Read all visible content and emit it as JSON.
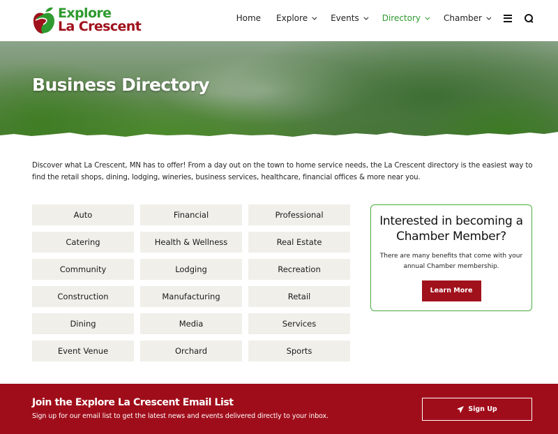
{
  "brand": {
    "line1": "Explore",
    "line2": "La Crescent",
    "colors": {
      "green": "#2e9a2f",
      "red": "#a0111c"
    }
  },
  "nav": {
    "items": [
      {
        "label": "Home",
        "has_dropdown": false,
        "active": false
      },
      {
        "label": "Explore",
        "has_dropdown": true,
        "active": false
      },
      {
        "label": "Events",
        "has_dropdown": true,
        "active": false
      },
      {
        "label": "Directory",
        "has_dropdown": true,
        "active": true
      },
      {
        "label": "Chamber",
        "has_dropdown": true,
        "active": false
      }
    ],
    "menu_icon": "hamburger-icon",
    "search_icon": "search-icon"
  },
  "hero": {
    "title": "Business Directory"
  },
  "intro": {
    "text": "Discover what La Crescent, MN has to offer! From a day out on the town to home service needs, the La Crescent directory is the easiest way to find the retail shops, dining, lodging, wineries, business services, healthcare, financial offices & more near you."
  },
  "categories": [
    "Auto",
    "Financial",
    "Professional",
    "Catering",
    "Health & Wellness",
    "Real Estate",
    "Community",
    "Lodging",
    "Recreation",
    "Construction",
    "Manufacturing",
    "Retail",
    "Dining",
    "Media",
    "Services",
    "Event Venue",
    "Orchard",
    "Sports"
  ],
  "chamber_card": {
    "title": "Interested in becoming a Chamber Member?",
    "text": "There are many benefits that come with your annual Chamber membership.",
    "button": "Learn More"
  },
  "footer": {
    "title": "Join the Explore La Crescent Email List",
    "subtitle": "Sign up for our email list to get the latest news and events delivered directly to your inbox.",
    "button": "Sign Up",
    "button_icon": "paper-plane-icon"
  }
}
